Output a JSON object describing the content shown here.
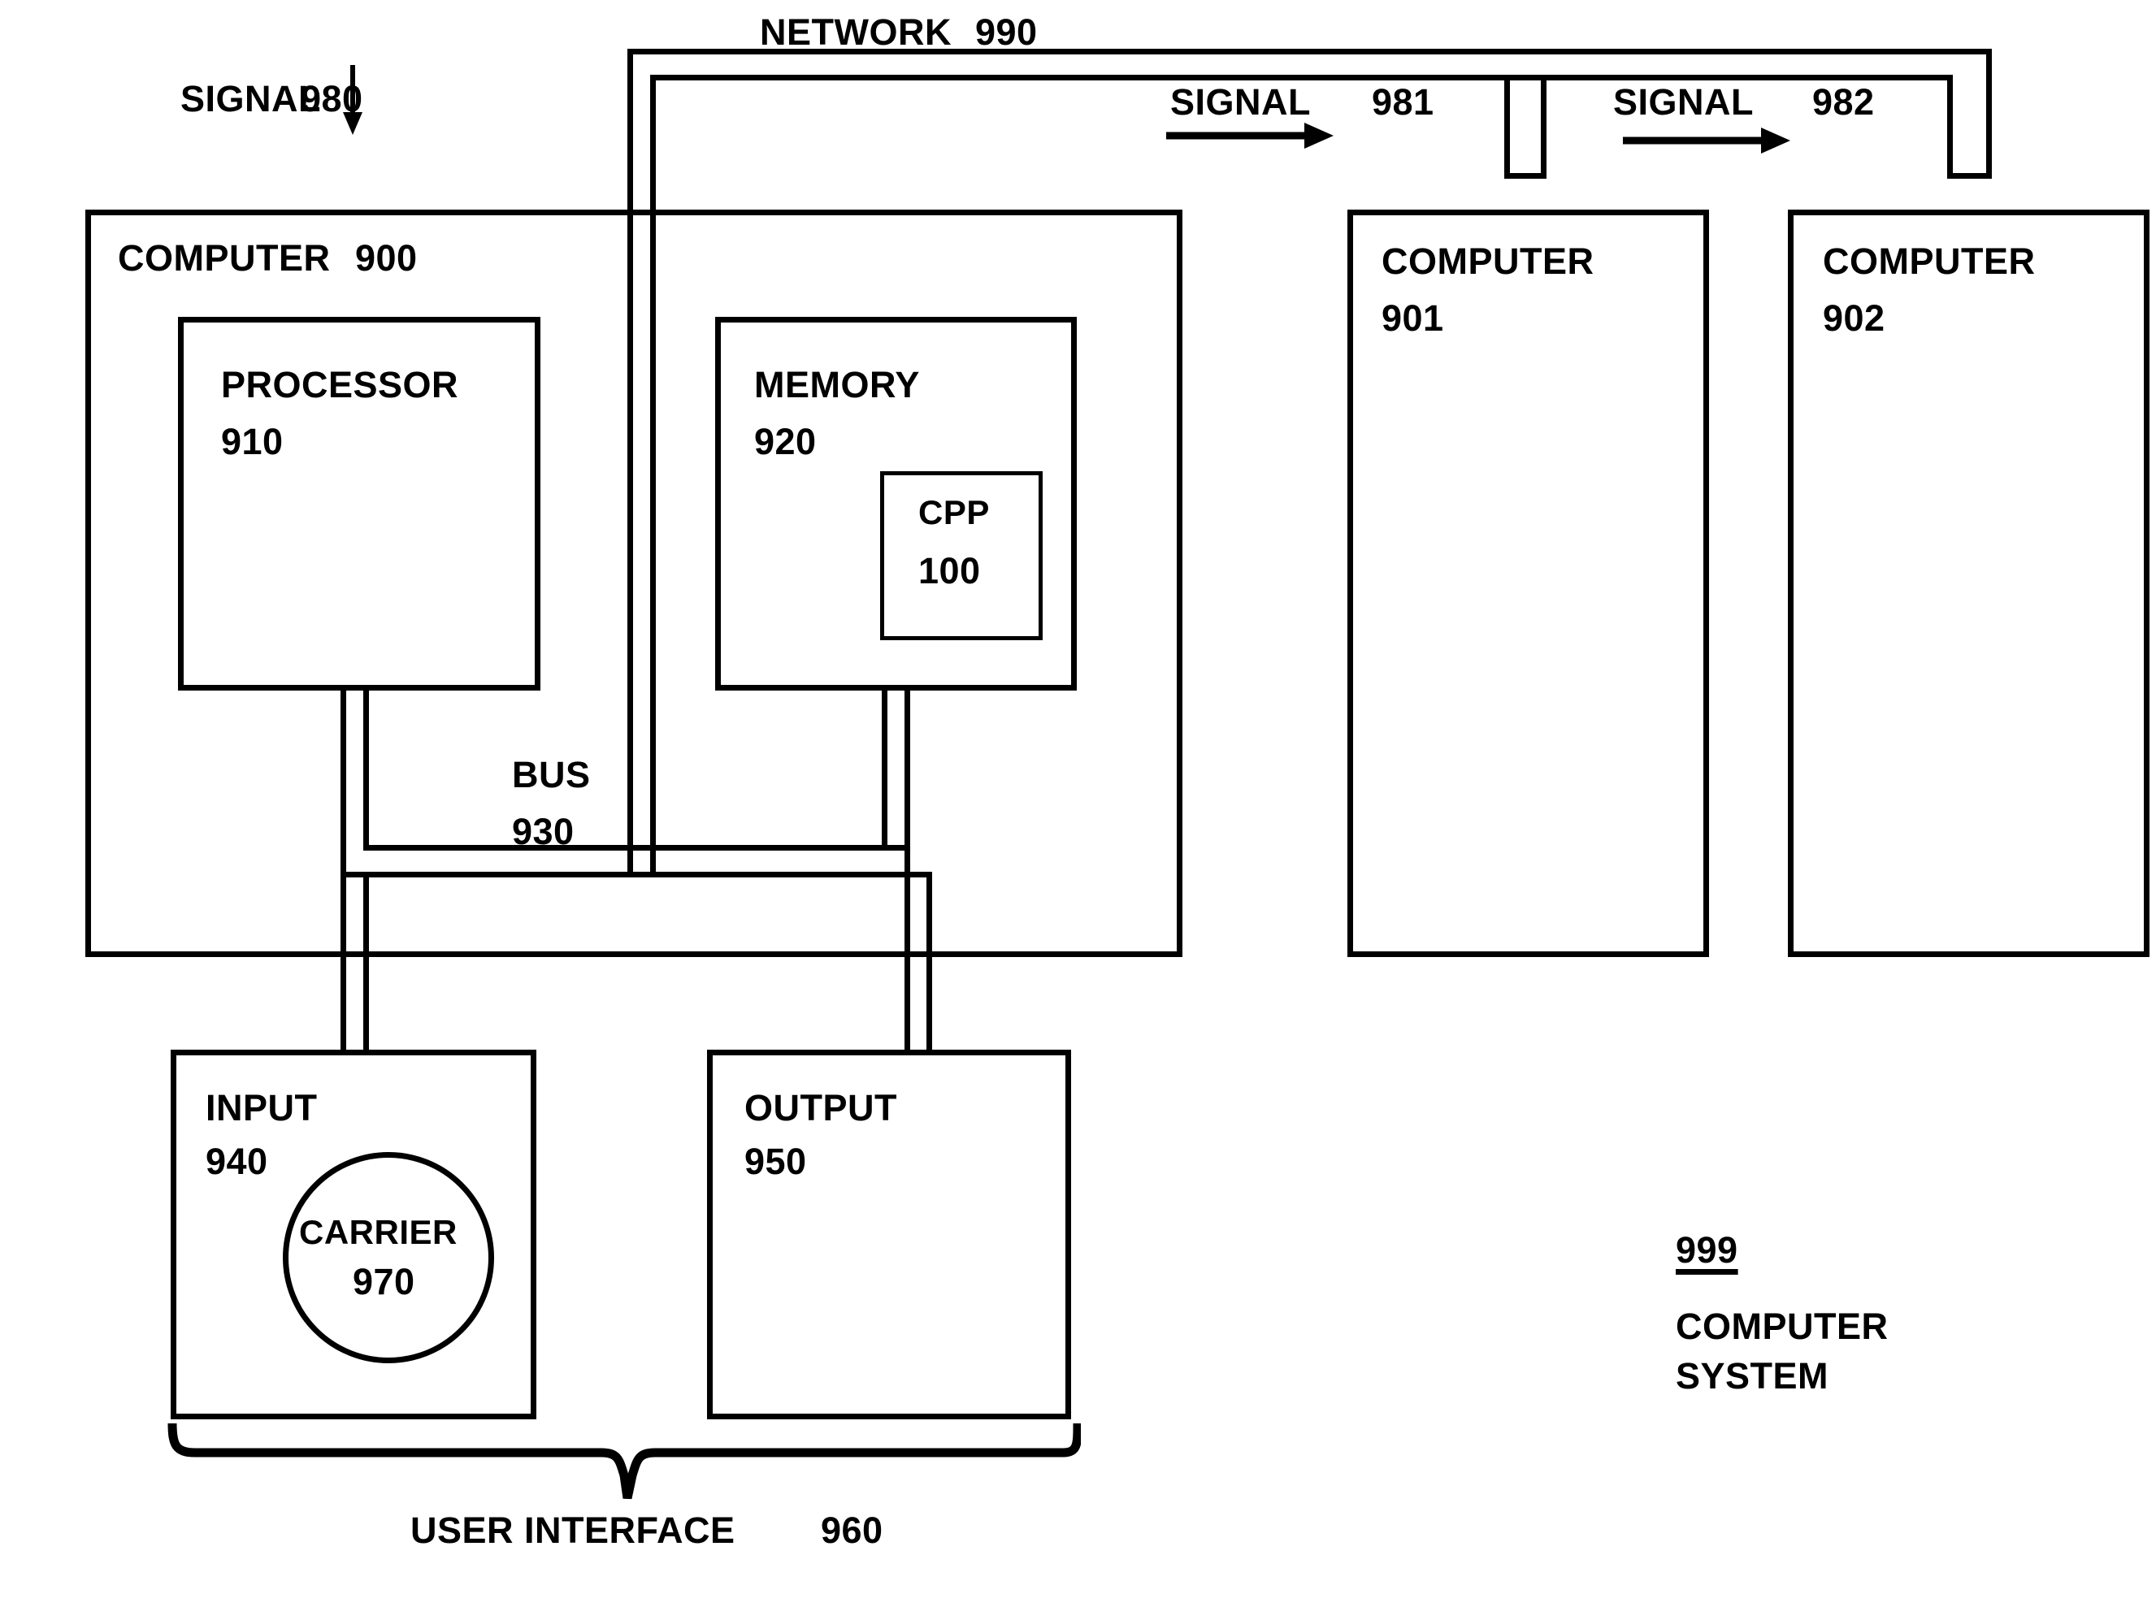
{
  "figure": {
    "reference_label": "999",
    "reference_caption_line1": "COMPUTER",
    "reference_caption_line2": "SYSTEM"
  },
  "network": {
    "label": "NETWORK",
    "number": "990"
  },
  "signals": [
    {
      "label": "SIGNAL",
      "number": "980",
      "direction": "down"
    },
    {
      "label": "SIGNAL",
      "number": "981",
      "direction": "right"
    },
    {
      "label": "SIGNAL",
      "number": "982",
      "direction": "right"
    }
  ],
  "computers": [
    {
      "label": "COMPUTER",
      "number": "900"
    },
    {
      "label": "COMPUTER",
      "number": "901"
    },
    {
      "label": "COMPUTER",
      "number": "902"
    }
  ],
  "blocks": {
    "processor": {
      "label": "PROCESSOR",
      "number": "910"
    },
    "memory": {
      "label": "MEMORY",
      "number": "920"
    },
    "cpp": {
      "label": "CPP",
      "number": "100"
    },
    "bus": {
      "label": "BUS",
      "number": "930"
    },
    "input": {
      "label": "INPUT",
      "number": "940"
    },
    "output": {
      "label": "OUTPUT",
      "number": "950"
    },
    "carrier": {
      "label": "CARRIER",
      "number": "970"
    }
  },
  "user_interface": {
    "label": "USER INTERFACE",
    "number": "960"
  },
  "colors": {
    "ink": "#000000",
    "paper": "#ffffff"
  }
}
